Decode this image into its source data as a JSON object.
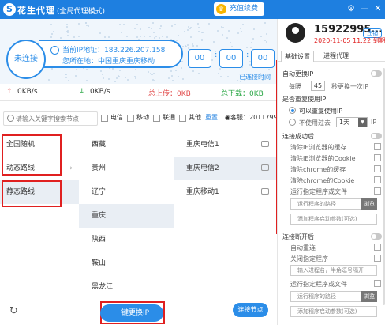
{
  "titlebar": {
    "logo": "S",
    "app_name": "花生代理",
    "mode": "(全局代理模式)",
    "renew": "充值续费",
    "crown": "♛",
    "menu": "⚙",
    "minimize": "—",
    "close": "✕"
  },
  "hero": {
    "status": "未连接",
    "ip_line": "当前IP地址：183.226.207.158",
    "location_line": "您所在地：中国重庆重庆移动",
    "timer": {
      "h": "00",
      "m": "00",
      "s": "00"
    },
    "disconnected": "已连接时间"
  },
  "stats": {
    "up_speed": "0KB/s",
    "down_speed": "0KB/s",
    "up_arrow": "↑",
    "down_arrow": "↓",
    "total_up": "总上传：0KB",
    "total_down": "总下载：0KB"
  },
  "filters": {
    "search_placeholder": "请输入关键字搜索节点",
    "telecom": "电信",
    "mobile": "移动",
    "unicom": "联通",
    "other": "其他",
    "reset": "重置",
    "support": "◉客服：2011799242"
  },
  "col1": [
    "全国随机",
    "动态路线",
    "静态路线"
  ],
  "col2": [
    "西藏",
    "贵州",
    "辽宁",
    "重庆",
    "陕西",
    "鞍山",
    "黑龙江"
  ],
  "col3": [
    "重庆电信1",
    "重庆电信2",
    "重庆移动1"
  ],
  "bottom": {
    "refresh": "↻",
    "change_ip": "一键更换IP",
    "connect": "连接节点"
  },
  "account": {
    "phone": "15922995...",
    "logout": "注销",
    "expiry": "2020-11-05 11:22 到期"
  },
  "settings": {
    "tab1": "基础设置",
    "tab2": "进程代理",
    "auto_switch": "自动更换IP",
    "every": "每隔",
    "interval": "45",
    "interval_unit": "秒更换一次IP",
    "reuse_title": "是否重复使用IP",
    "reuse_yes": "可以重复使用IP",
    "reuse_no": "不使用过去",
    "reuse_days": "1天",
    "reuse_ip": "IP",
    "after_connect": "连接成功后",
    "clear_ie_cache": "清除IE浏览器的缓存",
    "clear_ie_cookie": "清除IE浏览器的Cookie",
    "clear_chrome_cache": "清除chrome的缓存",
    "clear_chrome_cookie": "清除chrome的Cookie",
    "run_program": "运行指定程序或文件",
    "program_path": "运行程序的路径",
    "browse": "浏览",
    "launch_args": "添加程序启动参数(可选)",
    "disconnect_after": "连接断开后",
    "auto_reconnect": "自动重连",
    "close_program": "关闭指定程序",
    "process_names": "输入进程名，半角逗号隔开",
    "run_program2": "运行指定程序或文件",
    "program_path2": "运行程序的路径",
    "browse2": "浏览",
    "launch_args2": "添加程序启动参数(可选)"
  }
}
